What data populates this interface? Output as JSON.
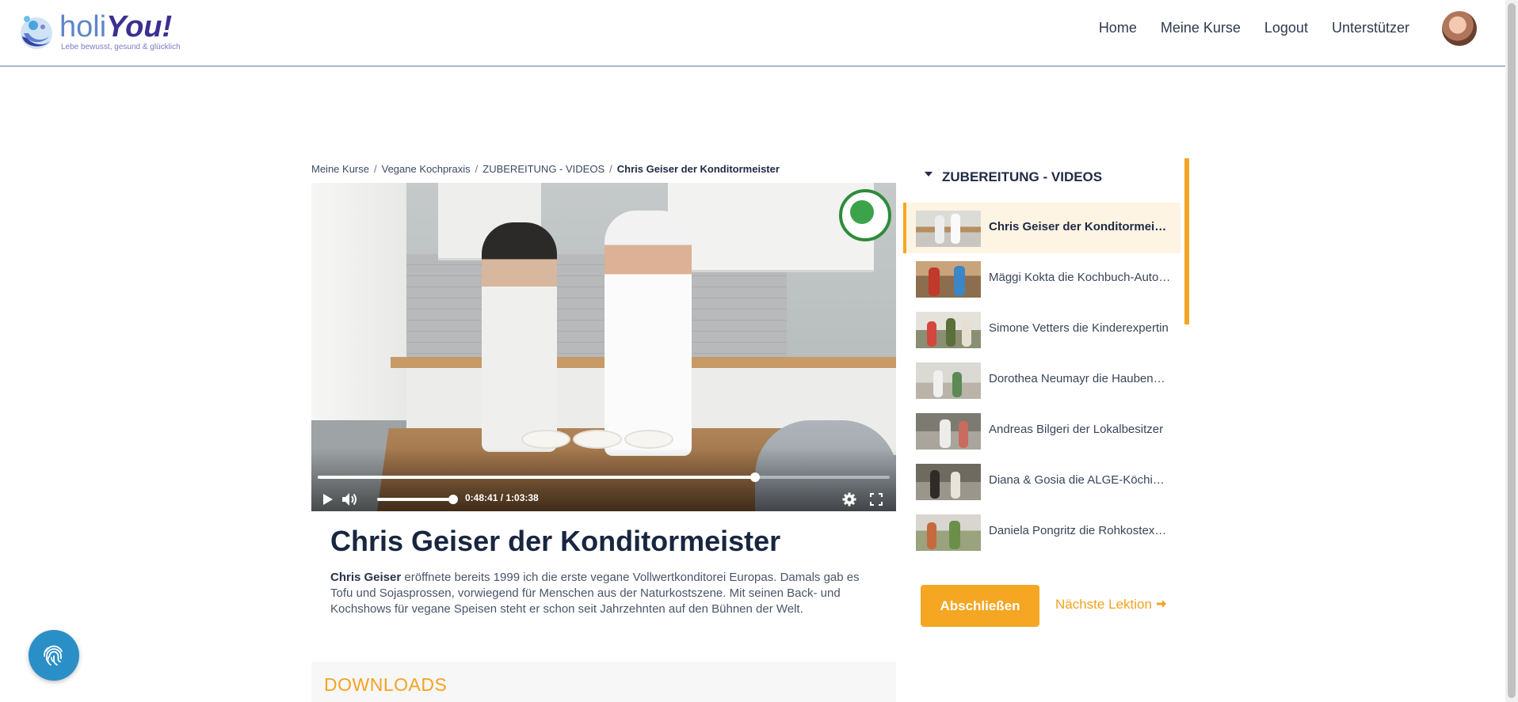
{
  "brand": {
    "name_part1": "holi",
    "name_part2": "You!",
    "tagline": "Lebe bewusst, gesund & glücklich"
  },
  "nav": {
    "items": [
      "Home",
      "Meine Kurse",
      "Logout",
      "Unterstützer"
    ]
  },
  "breadcrumb": {
    "items": [
      "Meine Kurse",
      "Vegane Kochpraxis",
      "ZUBEREITUNG - VIDEOS"
    ],
    "current": "Chris Geiser der Konditormeister"
  },
  "video": {
    "time": "0:48:41 / 1:03:38",
    "progress_fraction": 0.765,
    "volume_fraction": 1.0
  },
  "lesson": {
    "title": "Chris Geiser der Konditormeister",
    "desc_name": "Chris Geiser",
    "desc_rest": " eröffnete  bereits 1999 ich die erste vegane Vollwertkonditorei Europas. Damals gab es Tofu und Sojasprossen, vorwiegend für Menschen aus der Naturkostszene. Mit seinen Back- und Kochshows für vegane Speisen steht er schon seit Jahrzehnten auf den Bühnen der Welt."
  },
  "downloads": {
    "title": "DOWNLOADS"
  },
  "sidebar": {
    "section_title": "ZUBEREITUNG - VIDEOS",
    "items": [
      {
        "label": "Chris Geiser der Konditormeister",
        "active": true
      },
      {
        "label": "Mäggi Kokta die Kochbuch-Autorin",
        "active": false
      },
      {
        "label": "Simone Vetters die Kinderexpertin",
        "active": false
      },
      {
        "label": "Dorothea Neumayr die Haubenköchin",
        "active": false
      },
      {
        "label": "Andreas Bilgeri der Lokalbesitzer",
        "active": false
      },
      {
        "label": "Diana & Gosia die ALGE-Köchinnen",
        "active": false
      },
      {
        "label": "Daniela Pongritz die Rohkostexpertin",
        "active": false
      }
    ]
  },
  "actions": {
    "complete_label": "Abschließen",
    "next_label": "Nächste Lektion"
  },
  "icons": {
    "play": "play-icon",
    "volume": "volume-icon",
    "settings": "gear-icon",
    "fullscreen": "fullscreen-icon",
    "next": "arrow-right-icon",
    "fab": "fingerprint-icon"
  },
  "colors": {
    "accent": "#f5a623",
    "heading": "#182640",
    "fab": "#2a8fc7",
    "header_border": "#5d7fa0"
  }
}
